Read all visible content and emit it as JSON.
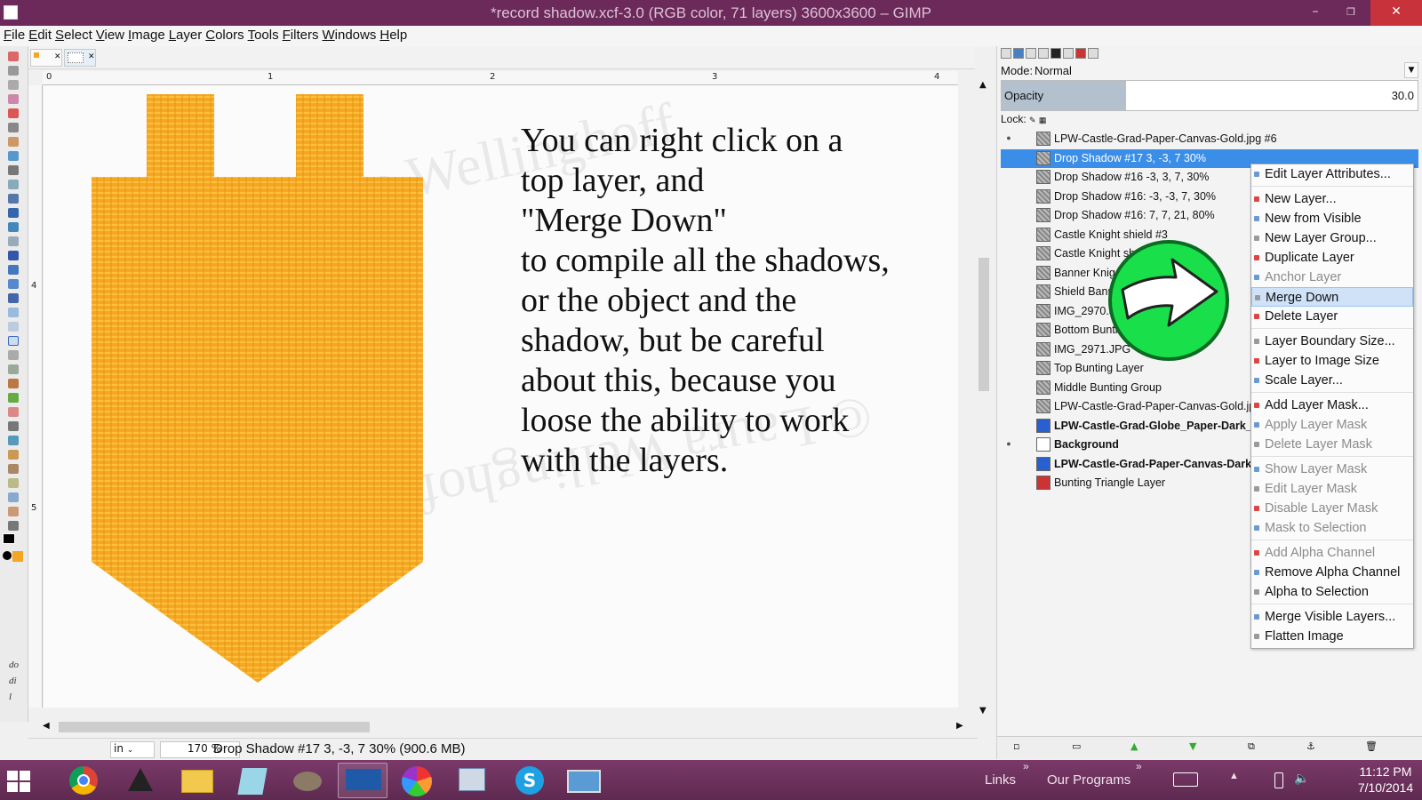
{
  "window": {
    "title": "*record shadow.xcf-3.0 (RGB color, 71 layers) 3600x3600 – GIMP",
    "min_glyph": "–",
    "max_glyph": "❐",
    "close_glyph": "✕"
  },
  "menu": [
    "File",
    "Edit",
    "Select",
    "View",
    "Image",
    "Layer",
    "Colors",
    "Tools",
    "Filters",
    "Windows",
    "Help"
  ],
  "rulers": {
    "h": [
      "0",
      "1",
      "2",
      "3",
      "4"
    ],
    "v": [
      "4",
      "5"
    ]
  },
  "left_edge_text": [
    "do",
    "di",
    "l"
  ],
  "canvas": {
    "instruction_lines": [
      "You can right click on a",
      "top layer, and",
      "\"Merge Down\"",
      "to compile all the shadows,",
      "or the object and the",
      "shadow, but be careful",
      "about this, because you",
      "loose the ability to work",
      "with the layers."
    ],
    "object_color": "#f5a623"
  },
  "status": {
    "units": "in",
    "zoom": "170 %",
    "message": "Drop Shadow #17 3, -3, 7 30% (900.6 MB)"
  },
  "layers_panel": {
    "mode_label": "Mode:",
    "mode_value": "Normal",
    "opacity_label": "Opacity",
    "opacity_value": "30.0",
    "opacity_fraction": 0.3,
    "lock_label": "Lock:",
    "layers": [
      {
        "name": "LPW-Castle-Grad-Paper-Canvas-Gold.jpg #6",
        "visible": true
      },
      {
        "name": "Drop Shadow #17 3, -3, 7 30%",
        "selected": true
      },
      {
        "name": "Drop Shadow #16 -3, 3, 7, 30%"
      },
      {
        "name": "Drop Shadow #16: -3, -3, 7, 30%"
      },
      {
        "name": "Drop Shadow #16: 7, 7, 21, 80%"
      },
      {
        "name": "Castle Knight shield #3"
      },
      {
        "name": "Castle Knight sh"
      },
      {
        "name": "Banner Knig"
      },
      {
        "name": "Shield Bann"
      },
      {
        "name": "IMG_2970.JPG"
      },
      {
        "name": "Bottom Bunting G"
      },
      {
        "name": "IMG_2971.JPG"
      },
      {
        "name": "Top Bunting Layer"
      },
      {
        "name": "Middle Bunting Group"
      },
      {
        "name": "LPW-Castle-Grad-Paper-Canvas-Gold.jpg"
      },
      {
        "name": "LPW-Castle-Grad-Globe_Paper-Dark_B",
        "bold": true,
        "thumb": "blue"
      },
      {
        "name": "Background",
        "bold": true,
        "thumb": "white",
        "visible": true
      },
      {
        "name": "LPW-Castle-Grad-Paper-Canvas-Dark_",
        "bold": true,
        "thumb": "blue"
      },
      {
        "name": "Bunting Triangle Layer",
        "thumb": "red"
      }
    ]
  },
  "context_menu": [
    {
      "label": "Edit Layer Attributes..."
    },
    {
      "sep": true
    },
    {
      "label": "New Layer..."
    },
    {
      "label": "New from Visible"
    },
    {
      "label": "New Layer Group..."
    },
    {
      "label": "Duplicate Layer"
    },
    {
      "label": "Anchor Layer",
      "disabled": true
    },
    {
      "label": "Merge Down",
      "hover": true
    },
    {
      "label": "Delete Layer"
    },
    {
      "sep": true
    },
    {
      "label": "Layer Boundary Size..."
    },
    {
      "label": "Layer to Image Size"
    },
    {
      "label": "Scale Layer..."
    },
    {
      "sep": true
    },
    {
      "label": "Add Layer Mask..."
    },
    {
      "label": "Apply Layer Mask",
      "disabled": true
    },
    {
      "label": "Delete Layer Mask",
      "disabled": true
    },
    {
      "sep": true
    },
    {
      "label": "Show Layer Mask",
      "disabled": true
    },
    {
      "label": "Edit Layer Mask",
      "disabled": true
    },
    {
      "label": "Disable Layer Mask",
      "disabled": true
    },
    {
      "label": "Mask to Selection",
      "disabled": true
    },
    {
      "sep": true
    },
    {
      "label": "Add Alpha Channel",
      "disabled": true
    },
    {
      "label": "Remove Alpha Channel"
    },
    {
      "label": "Alpha to Selection"
    },
    {
      "sep": true
    },
    {
      "label": "Merge Visible Layers..."
    },
    {
      "label": "Flatten Image"
    }
  ],
  "taskbar": {
    "links_label": "Links",
    "programs_label": "Our Programs",
    "time": "11:12 PM",
    "date": "7/10/2014"
  },
  "colors": {
    "titlebar": "#6b2a5a",
    "selection": "#3b8ee8",
    "arrow_green": "#19e04a"
  }
}
